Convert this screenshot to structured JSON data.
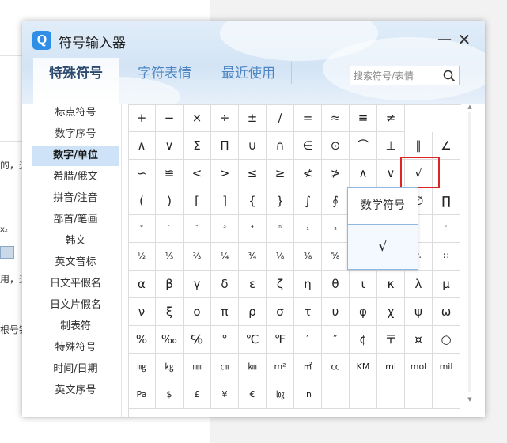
{
  "app": {
    "title": "符号输入器",
    "logo_letter": "Q"
  },
  "tabs": [
    {
      "label": "特殊符号",
      "active": true
    },
    {
      "label": "字符表情",
      "active": false
    },
    {
      "label": "最近使用",
      "active": false
    }
  ],
  "search": {
    "placeholder": "搜索符号/表情",
    "value": ""
  },
  "categories": [
    {
      "label": "标点符号",
      "active": false
    },
    {
      "label": "数字序号",
      "active": false
    },
    {
      "label": "数字/单位",
      "active": true
    },
    {
      "label": "希腊/俄文",
      "active": false
    },
    {
      "label": "拼音/注音",
      "active": false
    },
    {
      "label": "部首/笔画",
      "active": false
    },
    {
      "label": "韩文",
      "active": false
    },
    {
      "label": "英文音标",
      "active": false
    },
    {
      "label": "日文平假名",
      "active": false
    },
    {
      "label": "日文片假名",
      "active": false
    },
    {
      "label": "制表符",
      "active": false
    },
    {
      "label": "特殊符号",
      "active": false
    },
    {
      "label": "时间/日期",
      "active": false
    },
    {
      "label": "英文序号",
      "active": false
    }
  ],
  "symbols": [
    [
      "+",
      "−",
      "×",
      "÷",
      "±",
      "∕",
      "=",
      "≈",
      "≡",
      "≠",
      "",
      ""
    ],
    [
      "∧",
      "∨",
      "Σ",
      "Π",
      "∪",
      "∩",
      "∈",
      "⊙",
      "⌒",
      "⊥",
      "∥",
      "∠"
    ],
    [
      "∽",
      "≌",
      "<",
      ">",
      "≤",
      "≥",
      "≮",
      "≯",
      "∧",
      "∨",
      "√",
      ""
    ],
    [
      "(",
      ")",
      "[",
      "]",
      "{",
      "}",
      "∫",
      "∮",
      "",
      "",
      "∅",
      "∏"
    ],
    [
      "°",
      "′",
      "″",
      "³",
      "⁴",
      "ⁿ",
      "₁",
      "₂",
      "",
      "",
      "",
      "∶"
    ],
    [
      "½",
      "⅓",
      "⅔",
      "¼",
      "¾",
      "⅛",
      "⅜",
      "⅝",
      "",
      "",
      "∴",
      "∷"
    ],
    [
      "α",
      "β",
      "γ",
      "δ",
      "ε",
      "ζ",
      "η",
      "θ",
      "ι",
      "κ",
      "λ",
      "μ"
    ],
    [
      "ν",
      "ξ",
      "ο",
      "π",
      "ρ",
      "σ",
      "τ",
      "υ",
      "φ",
      "χ",
      "ψ",
      "ω"
    ],
    [
      "%",
      "‰",
      "℅",
      "°",
      "℃",
      "℉",
      "′",
      "″",
      "¢",
      "〒",
      "¤",
      "○"
    ],
    [
      "㎎",
      "㎏",
      "㎜",
      "㎝",
      "㎞",
      "m²",
      "㎡",
      "㏄",
      "KM",
      "ml",
      "mol",
      "mil"
    ],
    [
      "Pa",
      "$",
      "£",
      "¥",
      "€",
      "㏒",
      "ln",
      "",
      "",
      "",
      "",
      ""
    ]
  ],
  "selected_symbol": "√",
  "preview": {
    "label": "数学符号",
    "symbol": "√"
  },
  "background": {
    "lines": [
      "的，这",
      "用，这",
      "根号键"
    ],
    "sub_label": "x₂"
  },
  "colors": {
    "accent": "#2f8fe6",
    "tab_inactive": "#4d86c2",
    "highlight": "#e02323",
    "selected_category": "#cfe3f8"
  }
}
